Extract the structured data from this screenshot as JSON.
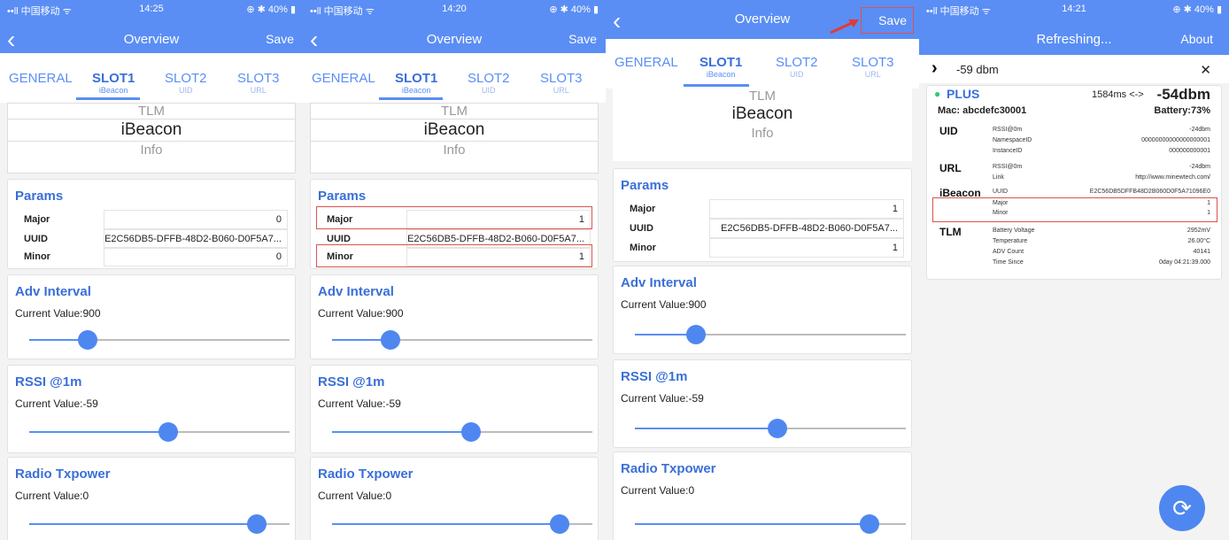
{
  "panels": [
    {
      "status": {
        "carrier": "••ll 中国移动 ᯤ",
        "time": "14:25",
        "battery": "⊕ ✱ 40% ▮"
      },
      "nav": {
        "back": "‹",
        "title": "Overview",
        "save": "Save"
      },
      "tabs": [
        {
          "main": "GENERAL",
          "sub": ""
        },
        {
          "main": "SLOT1",
          "sub": "iBeacon"
        },
        {
          "main": "SLOT2",
          "sub": "UID"
        },
        {
          "main": "SLOT3",
          "sub": "URL"
        }
      ],
      "frames": {
        "tlm": "TLM",
        "ibeacon": "iBeacon",
        "info": "Info"
      },
      "params": {
        "title": "Params",
        "major_label": "Major",
        "major_value": "0",
        "uuid_label": "UUID",
        "uuid_value": "E2C56DB5-DFFB-48D2-B060-D0F5A7...",
        "minor_label": "Minor",
        "minor_value": "0"
      },
      "adv": {
        "title": "Adv Interval",
        "value": "Current Value:900"
      },
      "rssi": {
        "title": "RSSI @1m",
        "value": "Current Value:-59"
      },
      "tx": {
        "title": "Radio Txpower",
        "value": "Current Value:0"
      }
    },
    {
      "status": {
        "carrier": "••ll 中国移动 ᯤ",
        "time": "14:20",
        "battery": "⊕ ✱ 40% ▮"
      },
      "nav": {
        "back": "‹",
        "title": "Overview",
        "save": "Save"
      },
      "tabs": [
        {
          "main": "GENERAL",
          "sub": ""
        },
        {
          "main": "SLOT1",
          "sub": "iBeacon"
        },
        {
          "main": "SLOT2",
          "sub": "UID"
        },
        {
          "main": "SLOT3",
          "sub": "URL"
        }
      ],
      "frames": {
        "tlm": "TLM",
        "ibeacon": "iBeacon",
        "info": "Info"
      },
      "params": {
        "title": "Params",
        "major_label": "Major",
        "major_value": "1",
        "uuid_label": "UUID",
        "uuid_value": "E2C56DB5-DFFB-48D2-B060-D0F5A7...",
        "minor_label": "Minor",
        "minor_value": "1"
      },
      "adv": {
        "title": "Adv Interval",
        "value": "Current Value:900"
      },
      "rssi": {
        "title": "RSSI @1m",
        "value": "Current Value:-59"
      },
      "tx": {
        "title": "Radio Txpower",
        "value": "Current Value:0"
      }
    },
    {
      "nav": {
        "back": "‹",
        "title": "Overview",
        "save": "Save"
      },
      "tabs": [
        {
          "main": "GENERAL",
          "sub": ""
        },
        {
          "main": "SLOT1",
          "sub": "iBeacon"
        },
        {
          "main": "SLOT2",
          "sub": "UID"
        },
        {
          "main": "SLOT3",
          "sub": "URL"
        }
      ],
      "frames": {
        "tlm": "TLM",
        "ibeacon": "iBeacon",
        "info": "Info"
      },
      "params": {
        "title": "Params",
        "major_label": "Major",
        "major_value": "1",
        "uuid_label": "UUID",
        "uuid_value": "E2C56DB5-DFFB-48D2-B060-D0F5A7...",
        "minor_label": "Minor",
        "minor_value": "1"
      },
      "adv": {
        "title": "Adv Interval",
        "value": "Current Value:900"
      },
      "rssi": {
        "title": "RSSI @1m",
        "value": "Current Value:-59"
      },
      "tx": {
        "title": "Radio Txpower",
        "value": "Current Value:0"
      }
    }
  ],
  "scanner": {
    "status": {
      "carrier": "••ll 中国移动 ᯤ",
      "time": "14:21",
      "battery": "⊕ ✱ 40% ▮"
    },
    "title": "Refreshing...",
    "about": "About",
    "filter": {
      "chevron": "›",
      "value": "-59 dbm",
      "close": "✕"
    },
    "device": {
      "dot": "●",
      "name": "PLUS",
      "interval": "1584ms <->",
      "rssi": "-54dbm",
      "mac": "Mac: abcdefc30001",
      "battery": "Battery:73%"
    },
    "uid": {
      "label": "UID",
      "rows": [
        [
          "RSSI@0m",
          "-24dbm"
        ],
        [
          "NamespaceID",
          "00000000000000000001"
        ],
        [
          "InstanceID",
          "000000000001"
        ]
      ]
    },
    "url": {
      "label": "URL",
      "rows": [
        [
          "RSSI@0m",
          "-24dbm"
        ],
        [
          "Link",
          "http://www.minewtech.com/"
        ]
      ]
    },
    "ibeacon": {
      "label": "iBeacon",
      "rows": [
        [
          "UUID",
          "E2C56DB5DFFB48D2B060D0F5A71096E0"
        ],
        [
          "Major",
          "1"
        ],
        [
          "Minor",
          "1"
        ]
      ]
    },
    "tlm": {
      "label": "TLM",
      "rows": [
        [
          "Battery Voltage",
          "2952mV"
        ],
        [
          "Temperature",
          "26.00°C"
        ],
        [
          "ADV Count",
          "40141"
        ],
        [
          "Time Since",
          "0day 04:21:39.000"
        ]
      ]
    },
    "fab_icon": "⟳"
  },
  "colors": {
    "accent": "#5a8ef5",
    "highlight": "#d9534f"
  }
}
